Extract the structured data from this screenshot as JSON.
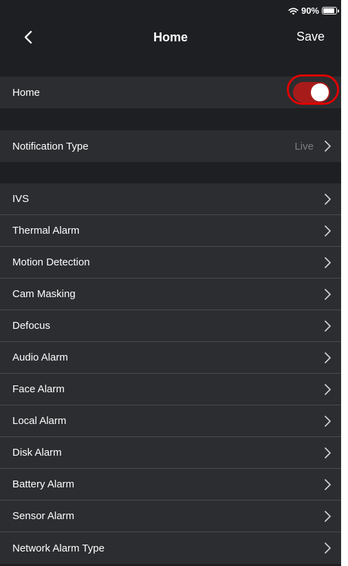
{
  "status_bar": {
    "wifi_icon": "wifi-icon",
    "battery_percent": "90%",
    "battery_level": 0.9
  },
  "nav": {
    "back_icon": "chevron-left-icon",
    "title": "Home",
    "save_label": "Save"
  },
  "home_toggle": {
    "label": "Home",
    "on": true,
    "toggle_color": "#a81b1b",
    "highlight_color": "#e00000"
  },
  "notification": {
    "label": "Notification Type",
    "value": "Live"
  },
  "alarms": [
    {
      "label": "IVS"
    },
    {
      "label": "Thermal Alarm"
    },
    {
      "label": "Motion Detection"
    },
    {
      "label": "Cam Masking"
    },
    {
      "label": "Defocus"
    },
    {
      "label": "Audio Alarm"
    },
    {
      "label": "Face Alarm"
    },
    {
      "label": "Local Alarm"
    },
    {
      "label": "Disk Alarm"
    },
    {
      "label": "Battery Alarm"
    },
    {
      "label": "Sensor Alarm"
    },
    {
      "label": "Network Alarm Type"
    }
  ]
}
